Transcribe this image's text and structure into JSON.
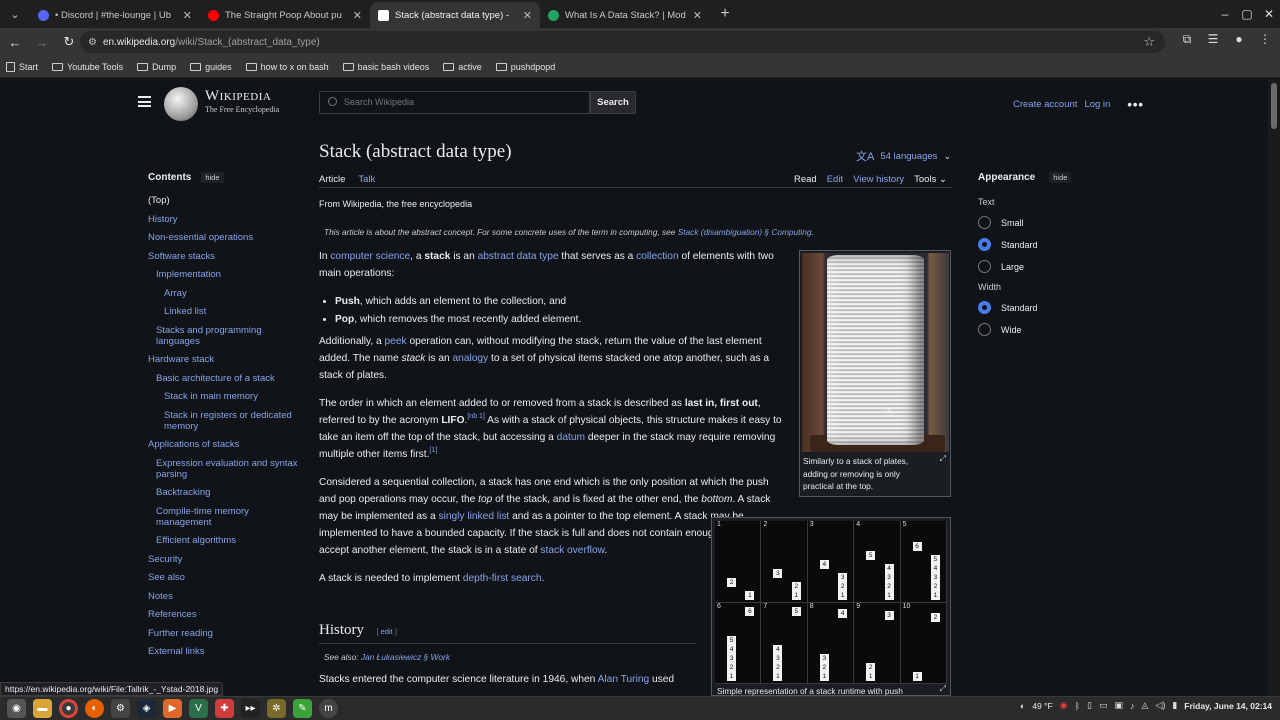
{
  "browser": {
    "tabs": [
      {
        "title": "• Discord | #the-lounge | Ub",
        "color": "#5865f2",
        "active": false
      },
      {
        "title": "The Straight Poop About pu",
        "color": "#ff0000",
        "active": false
      },
      {
        "title": "Stack (abstract data type) -",
        "color": "#ffffff",
        "active": true
      },
      {
        "title": "What Is A Data Stack? | Mod",
        "color": "#1fa463",
        "active": false
      }
    ],
    "url_host": "en.wikipedia.org",
    "url_path": "/wiki/Stack_(abstract_data_type)",
    "bookmarks": [
      "Start",
      "Youtube Tools",
      "Dump",
      "guides",
      "how to x on bash",
      "basic bash videos",
      "active",
      "pushdpopd"
    ]
  },
  "wiki": {
    "wordmark": "Wikipedia",
    "tagline": "The Free Encyclopedia",
    "search_placeholder": "Search Wikipedia",
    "search_button": "Search",
    "create_account": "Create account",
    "login": "Log in",
    "title": "Stack (abstract data type)",
    "languages": "54 languages",
    "tab_article": "Article",
    "tab_talk": "Talk",
    "tab_read": "Read",
    "tab_edit": "Edit",
    "tab_history": "View history",
    "tab_tools": "Tools",
    "from": "From Wikipedia, the free encyclopedia",
    "hatnote_pre": "This article is about the abstract concept. For some concrete uses of the term in computing, see ",
    "hatnote_link": "Stack (disambiguation) § Computing",
    "hatnote_post": "."
  },
  "toc": {
    "heading": "Contents",
    "hide": "hide",
    "items": [
      {
        "label": "(Top)",
        "level": 1
      },
      {
        "label": "History",
        "level": 1
      },
      {
        "label": "Non-essential operations",
        "level": 1
      },
      {
        "label": "Software stacks",
        "level": 1
      },
      {
        "label": "Implementation",
        "level": 2
      },
      {
        "label": "Array",
        "level": 3
      },
      {
        "label": "Linked list",
        "level": 3
      },
      {
        "label": "Stacks and programming languages",
        "level": 2
      },
      {
        "label": "Hardware stack",
        "level": 1
      },
      {
        "label": "Basic architecture of a stack",
        "level": 2
      },
      {
        "label": "Stack in main memory",
        "level": 3
      },
      {
        "label": "Stack in registers or dedicated memory",
        "level": 3
      },
      {
        "label": "Applications of stacks",
        "level": 1
      },
      {
        "label": "Expression evaluation and syntax parsing",
        "level": 2
      },
      {
        "label": "Backtracking",
        "level": 2
      },
      {
        "label": "Compile-time memory management",
        "level": 2
      },
      {
        "label": "Efficient algorithms",
        "level": 2
      },
      {
        "label": "Security",
        "level": 1
      },
      {
        "label": "See also",
        "level": 1
      },
      {
        "label": "Notes",
        "level": 1
      },
      {
        "label": "References",
        "level": 1
      },
      {
        "label": "Further reading",
        "level": 1
      },
      {
        "label": "External links",
        "level": 1
      }
    ]
  },
  "article": {
    "p1": [
      {
        "t": "In "
      },
      {
        "t": "computer science",
        "link": true
      },
      {
        "t": ", a "
      },
      {
        "t": "stack",
        "b": true
      },
      {
        "t": " is an "
      },
      {
        "t": "abstract data type",
        "link": true
      },
      {
        "t": " that serves as a "
      },
      {
        "t": "collection",
        "link": true
      },
      {
        "t": " of elements with two main operations:"
      }
    ],
    "li1": [
      {
        "t": "Push",
        "b": true
      },
      {
        "t": ", which adds an element to the collection, and"
      }
    ],
    "li2": [
      {
        "t": "Pop",
        "b": true
      },
      {
        "t": ", which removes the most recently added element."
      }
    ],
    "p2": [
      {
        "t": "Additionally, a "
      },
      {
        "t": "peek",
        "link": true
      },
      {
        "t": " operation can, without modifying the stack, return the value of the last element added. The name "
      },
      {
        "t": "stack",
        "i": true
      },
      {
        "t": " is an "
      },
      {
        "t": "analogy",
        "link": true
      },
      {
        "t": " to a set of physical items stacked one atop another, such as a stack of plates."
      }
    ],
    "p3": [
      {
        "t": "The order in which an element added to or removed from a stack is described as "
      },
      {
        "t": "last in, first out",
        "b": true
      },
      {
        "t": ", referred to by the acronym "
      },
      {
        "t": "LIFO",
        "b": true
      },
      {
        "t": ".",
        "sup_after": "[nb 1]"
      },
      {
        "t": " As with a stack of physical objects, this structure makes it easy to take an item off the top of the stack, but accessing a "
      },
      {
        "t": "datum",
        "link": true
      },
      {
        "t": " deeper in the stack may require removing multiple other items first.",
        "sup_after": "[1]"
      }
    ],
    "p4": [
      {
        "t": "Considered a sequential collection, a stack has one end which is the only position at which the push and pop operations may occur, the "
      },
      {
        "t": "top",
        "i": true
      },
      {
        "t": " of the stack, and is fixed at the other end, the "
      },
      {
        "t": "bottom",
        "i": true
      },
      {
        "t": ". A stack may be implemented as a "
      },
      {
        "t": "singly linked list",
        "link": true
      },
      {
        "t": " and as a pointer to the top element. A stack may be implemented to have a bounded capacity. If the stack is full and does not contain enough space to accept another element, the stack is in a state of "
      },
      {
        "t": "stack overflow",
        "link": true
      },
      {
        "t": "."
      }
    ],
    "p5": [
      {
        "t": "A stack is needed to implement "
      },
      {
        "t": "depth-first search",
        "link": true
      },
      {
        "t": "."
      }
    ],
    "history_heading": "History",
    "edit_label": "edit",
    "edit_open": "[",
    "edit_close": "]",
    "see_also_pre": "See also: ",
    "see_also_link": "Jan Łukasiewicz § Work",
    "history_text_pre": "Stacks entered the computer science literature in 1946, when ",
    "history_text_link": "Alan Turing",
    "history_text_post": " used"
  },
  "figures": {
    "plates_caption": "Similarly to a stack of plates, adding or removing is only practical at the top.",
    "runtime_caption": "Simple representation of a stack runtime with push",
    "runtime_frames": [
      {
        "n": "1",
        "stack": [
          "1"
        ],
        "pushed": "2"
      },
      {
        "n": "2",
        "stack": [
          "2",
          "1"
        ],
        "pushed": "3"
      },
      {
        "n": "3",
        "stack": [
          "3",
          "2",
          "1"
        ],
        "pushed": "4"
      },
      {
        "n": "4",
        "stack": [
          "4",
          "3",
          "2",
          "1"
        ],
        "pushed": "5"
      },
      {
        "n": "5",
        "stack": [
          "5",
          "4",
          "3",
          "2",
          "1"
        ],
        "pushed": "6"
      },
      {
        "n": "6",
        "stack": [
          "5",
          "4",
          "3",
          "2",
          "1"
        ],
        "pushed": "6"
      },
      {
        "n": "7",
        "stack": [
          "4",
          "3",
          "2",
          "1"
        ],
        "pushed": "5"
      },
      {
        "n": "8",
        "stack": [
          "3",
          "2",
          "1"
        ],
        "pushed": "4"
      },
      {
        "n": "9",
        "stack": [
          "2",
          "1"
        ],
        "pushed": "3"
      },
      {
        "n": "10",
        "stack": [
          "1"
        ],
        "pushed": "2"
      }
    ]
  },
  "appearance": {
    "heading": "Appearance",
    "hide": "hide",
    "text_label": "Text",
    "text_options": [
      {
        "label": "Small",
        "on": false
      },
      {
        "label": "Standard",
        "on": true
      },
      {
        "label": "Large",
        "on": false
      }
    ],
    "width_label": "Width",
    "width_options": [
      {
        "label": "Standard",
        "on": true
      },
      {
        "label": "Wide",
        "on": false
      }
    ]
  },
  "status_url": "https://en.wikipedia.org/wiki/File:Tallrik_-_Ystad-2018.jpg",
  "tray": {
    "weather": "49 °F",
    "datetime": "Friday, June 14, 02:14"
  }
}
